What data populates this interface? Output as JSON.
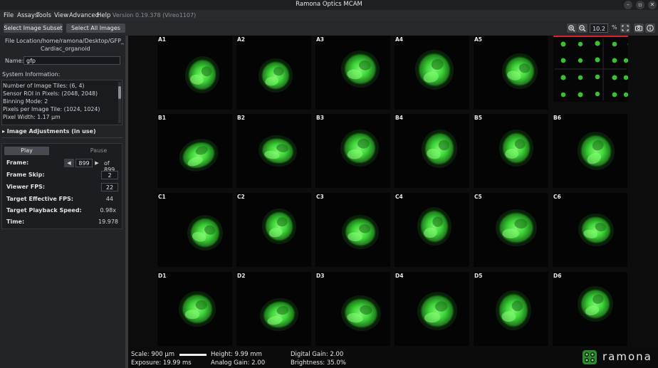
{
  "window": {
    "title": "Ramona Optics MCAM",
    "minimize": "–",
    "maximize": "▫",
    "close": "✕"
  },
  "menu": {
    "items": [
      {
        "name": "file",
        "label": "File"
      },
      {
        "name": "assays",
        "label": "Assays"
      },
      {
        "name": "tools",
        "label": "Tools"
      },
      {
        "name": "view",
        "label": "View"
      },
      {
        "name": "advanced",
        "label": "Advanced"
      },
      {
        "name": "help",
        "label": "Help"
      }
    ],
    "version": "Version 0.19.378 (Vireo1107)"
  },
  "toolbar": {
    "select_subset": "Select Image Subset",
    "select_all": "Select All Images",
    "zoom_value": "10.2",
    "zoom_unit": "%",
    "icons": [
      "zoom-in-icon",
      "zoom-out-icon",
      "fit-screen-icon",
      "camera-icon",
      "info-icon"
    ]
  },
  "panel": {
    "file_location_label": "File Location:",
    "file_location_line1": "/home/ramona/Desktop/GFP_",
    "file_location_line2": "Cardiac_organoid",
    "name_label": "Name:",
    "name_value": "gfp",
    "system_info_label": "System Information:",
    "system_info": [
      "Number of Image Tiles: (6, 4)",
      "Sensor ROI in Pixels: (2048, 2048)",
      "Binning Mode: 2",
      "Pixels per Image Tile: (1024, 1024)",
      "Pixel Width: 1.17 µm"
    ],
    "image_adjustments": "▸ Image Adjustments (in use)",
    "playback": {
      "play": "Play",
      "pause": "Pause",
      "frame_label": "Frame:",
      "frame_value": "899",
      "frame_of": "of 899",
      "frame_skip_label": "Frame Skip:",
      "frame_skip_value": "2",
      "viewer_fps_label": "Viewer FPS:",
      "viewer_fps_value": "22",
      "target_fps_label": "Target Effective FPS:",
      "target_fps_value": "44",
      "target_speed_label": "Target Playback Speed:",
      "target_speed_value": "0.98x",
      "time_label": "Time:",
      "time_value": "19.978"
    }
  },
  "grid": {
    "rows": [
      [
        "A1",
        "A2",
        "A3",
        "A4",
        "A5"
      ],
      [
        "B1",
        "B2",
        "B3",
        "B4",
        "B5",
        "B6"
      ],
      [
        "C1",
        "C2",
        "C3",
        "C4",
        "C5",
        "C6"
      ],
      [
        "D1",
        "D2",
        "D3",
        "D4",
        "D5",
        "D6"
      ]
    ],
    "fluorescence_color": "#3fd63a"
  },
  "status": {
    "scale": "Scale: 900 µm",
    "exposure": "Exposure: 19.99 ms",
    "height": "Height: 9.99 mm",
    "analog_gain": "Analog Gain: 2.00",
    "digital_gain": "Digital Gain: 2.00",
    "brightness": "Brightness: 35.0%",
    "logo_text": "ramona"
  }
}
